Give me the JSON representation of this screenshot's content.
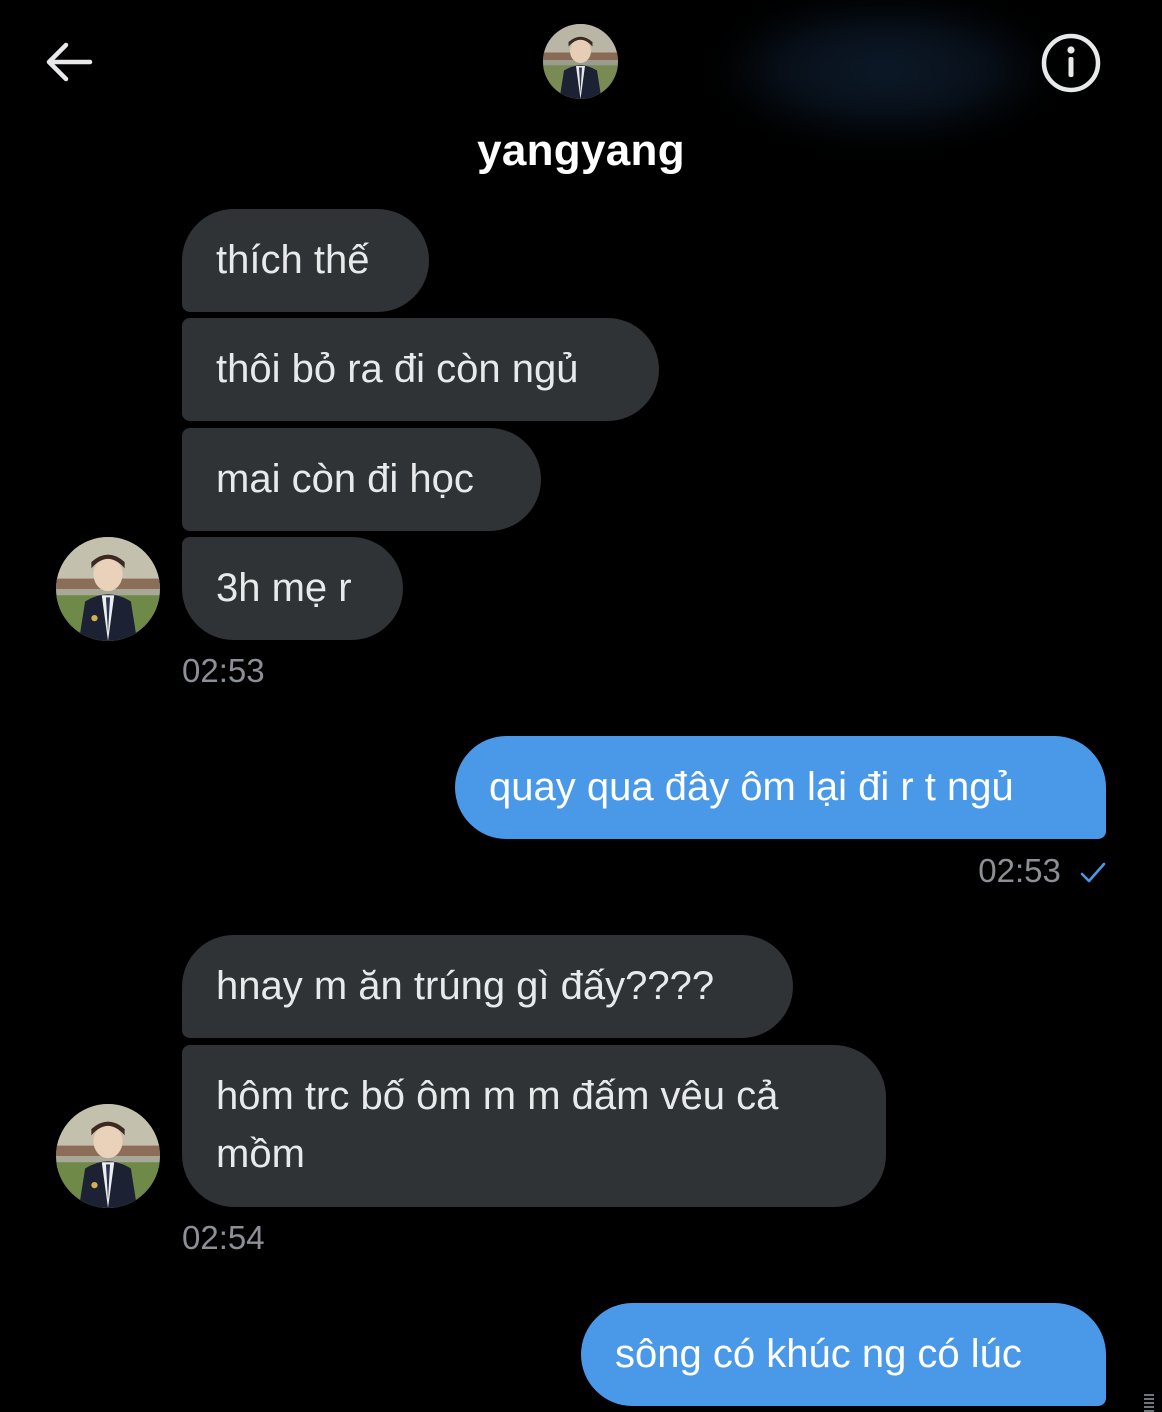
{
  "header": {
    "name": "yangyang",
    "back_icon": "arrow-left-icon",
    "info_icon": "info-icon"
  },
  "messages": [
    {
      "id": "m1",
      "direction": "in",
      "text": "thích thế"
    },
    {
      "id": "m2",
      "direction": "in",
      "text": "thôi bỏ ra đi còn ngủ"
    },
    {
      "id": "m3",
      "direction": "in",
      "text": "mai còn đi học"
    },
    {
      "id": "m4",
      "direction": "in",
      "text": "3h mẹ r"
    },
    {
      "id": "m5",
      "direction": "out",
      "text": "quay qua đây ôm lại đi r t ngủ"
    },
    {
      "id": "m6",
      "direction": "in",
      "text": "hnay m ăn trúng gì đấy????"
    },
    {
      "id": "m7",
      "direction": "in",
      "line1": "hôm trc bố ôm m m đấm vêu cả",
      "line2": "mồm"
    },
    {
      "id": "m8",
      "direction": "out",
      "text": "sông có khúc ng có lúc"
    }
  ],
  "timestamps": {
    "group1": "02:53",
    "group2": "02:53",
    "group3": "02:54"
  },
  "colors": {
    "background": "#000000",
    "incoming_bubble": "#2f3336",
    "outgoing_bubble": "#4a99e9",
    "timestamp": "#8b9096",
    "read_check": "#4a99e9"
  }
}
